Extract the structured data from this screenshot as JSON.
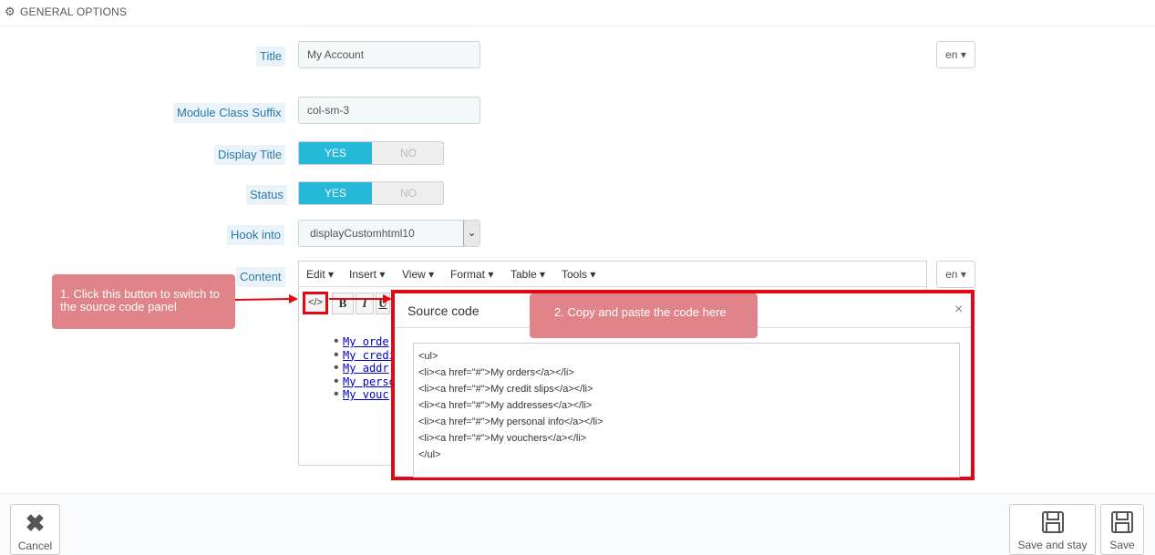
{
  "panel": {
    "title": "GENERAL OPTIONS",
    "icon": "gears-icon"
  },
  "form": {
    "title": {
      "label": "Title",
      "value": "My Account",
      "lang": "en"
    },
    "module_class_suffix": {
      "label": "Module Class Suffix",
      "value": "col-sm-3"
    },
    "display_title": {
      "label": "Display Title",
      "yes": "YES",
      "no": "NO",
      "selected": "YES"
    },
    "status": {
      "label": "Status",
      "yes": "YES",
      "no": "NO",
      "selected": "YES"
    },
    "hook_into": {
      "label": "Hook into",
      "value": "displayCustomhtml10"
    },
    "content": {
      "label": "Content",
      "lang": "en"
    }
  },
  "editor": {
    "menu": [
      "Edit",
      "Insert",
      "View",
      "Format",
      "Table",
      "Tools"
    ],
    "toolbar": {
      "source_code": "</>",
      "bold": "B",
      "italic": "I",
      "underline": "U"
    },
    "list": [
      "My orde",
      "My credi",
      "My addr",
      "My perso",
      "My vouc"
    ]
  },
  "modal": {
    "title": "Source code",
    "close": "×",
    "code_lines": [
      "<ul>",
      "<li><a href=\"#\">My orders</a></li>",
      "<li><a href=\"#\">My credit slips</a></li>",
      "<li><a href=\"#\">My addresses</a></li>",
      "<li><a href=\"#\">My personal info</a></li>",
      "<li><a href=\"#\">My vouchers</a></li>",
      "</ul>"
    ]
  },
  "annotations": {
    "step1": "1. Click this button to switch to the source code panel",
    "step2": "2. Copy and paste the code here"
  },
  "footer": {
    "cancel": "Cancel",
    "save_and_stay": "Save and stay",
    "save": "Save"
  },
  "colors": {
    "accent": "#25b9d7",
    "highlight": "#e30613",
    "callout": "#e08489",
    "label": "#2a79a8"
  }
}
